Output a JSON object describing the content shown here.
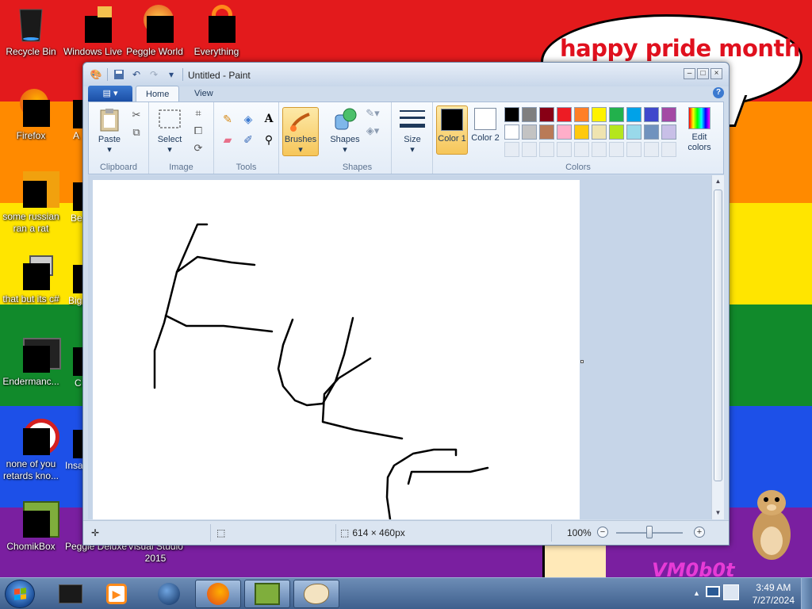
{
  "desktop": {
    "speech_bubble": "happy pride month",
    "wallpaper_logo": "VM0b0t",
    "icons": [
      {
        "label": "Recycle Bin",
        "icon": "recycle-bin-icon"
      },
      {
        "label": "Windows Live",
        "icon": "windows-live-icon"
      },
      {
        "label": "Peggle World",
        "icon": "peggle-world-icon"
      },
      {
        "label": "Everything",
        "icon": "everything-icon"
      },
      {
        "label": "Firefox",
        "icon": "firefox-icon"
      },
      {
        "label": "some russian ran a rat",
        "icon": "ie-icon"
      },
      {
        "label": "that but its c#",
        "icon": "folder-stack-icon"
      },
      {
        "label": "Endermanc...",
        "icon": "endermanch-icon"
      },
      {
        "label": "none of you retards kno...",
        "icon": "chrome-like-icon"
      },
      {
        "label": "ChomikBox",
        "icon": "chomikbox-icon"
      },
      {
        "label": "Peggle Deluxe",
        "icon": "peggle-deluxe-icon"
      },
      {
        "label": "Visual Studio 2015",
        "icon": "visual-studio-icon"
      }
    ],
    "partial_labels": [
      "A",
      "Be",
      "Big",
      "C",
      "Insa"
    ]
  },
  "paint": {
    "title": "Untitled - Paint",
    "tabs": {
      "home": "Home",
      "view": "View"
    },
    "clipboard": {
      "paste": "Paste",
      "label": "Clipboard"
    },
    "image": {
      "select": "Select",
      "label": "Image"
    },
    "tools": {
      "label": "Tools"
    },
    "brushes": {
      "label": "Brushes"
    },
    "shapes": {
      "button": "Shapes",
      "label": "Shapes"
    },
    "size": {
      "label": "Size"
    },
    "colors": {
      "color1": "Color 1",
      "color2": "Color 2",
      "edit": "Edit colors",
      "label": "Colors",
      "color1_value": "#000000",
      "color2_value": "#ffffff",
      "palette_row1": [
        "#000000",
        "#7f7f7f",
        "#880015",
        "#ed1c24",
        "#ff7f27",
        "#fff200",
        "#22b14c",
        "#00a2e8",
        "#3f48cc",
        "#a349a4"
      ],
      "palette_row2": [
        "#ffffff",
        "#c3c3c3",
        "#b97a57",
        "#ffaec9",
        "#ffc90e",
        "#efe4b0",
        "#b5e61d",
        "#99d9ea",
        "#7092be",
        "#c8bfe7"
      ]
    },
    "status": {
      "dimensions": "614 × 460px",
      "zoom": "100%",
      "zoom_level_fraction": 0.5
    }
  },
  "taskbar": {
    "time": "3:49 AM",
    "date": "7/27/2024",
    "items": [
      "start-orb",
      "dark-box-app",
      "media-player",
      "globe-app",
      "firefox",
      "chomikbox",
      "paint"
    ]
  }
}
